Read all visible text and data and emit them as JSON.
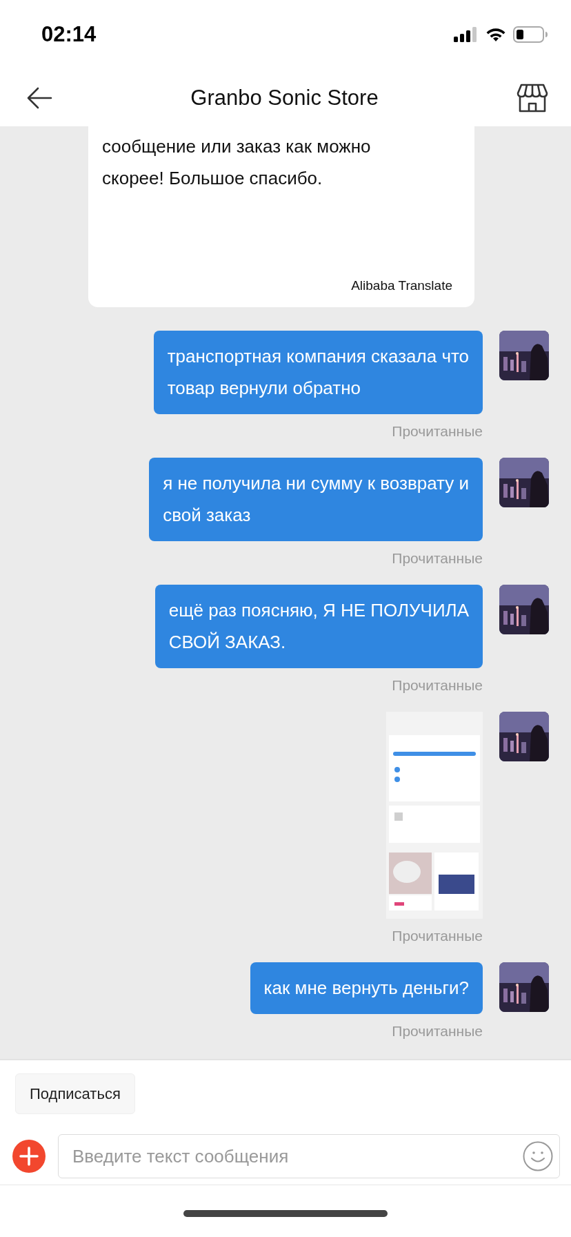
{
  "status_bar": {
    "time": "02:14"
  },
  "header": {
    "title": "Granbo Sonic Store"
  },
  "messages": [
    {
      "kind": "incoming",
      "text": "сообщение или заказ как можно\nскорее! Большое спасибо.",
      "translator": "Alibaba Translate"
    },
    {
      "kind": "outgoing_text",
      "text": "транспортная компания сказала что\nтовар вернули обратно",
      "status": "Прочитанные"
    },
    {
      "kind": "outgoing_text",
      "text": "я не получила ни сумму к возврату и\nсвой заказ",
      "status": "Прочитанные"
    },
    {
      "kind": "outgoing_text",
      "text": "ещё раз поясняю, Я НЕ ПОЛУЧИЛА\nСВОЙ ЗАКАЗ.",
      "status": "Прочитанные"
    },
    {
      "kind": "outgoing_image",
      "status": "Прочитанные"
    },
    {
      "kind": "outgoing_text",
      "text": "как мне вернуть деньги?",
      "status": "Прочитанные"
    }
  ],
  "subscribe_button": "Подписаться",
  "composer": {
    "placeholder": "Введите текст сообщения"
  }
}
